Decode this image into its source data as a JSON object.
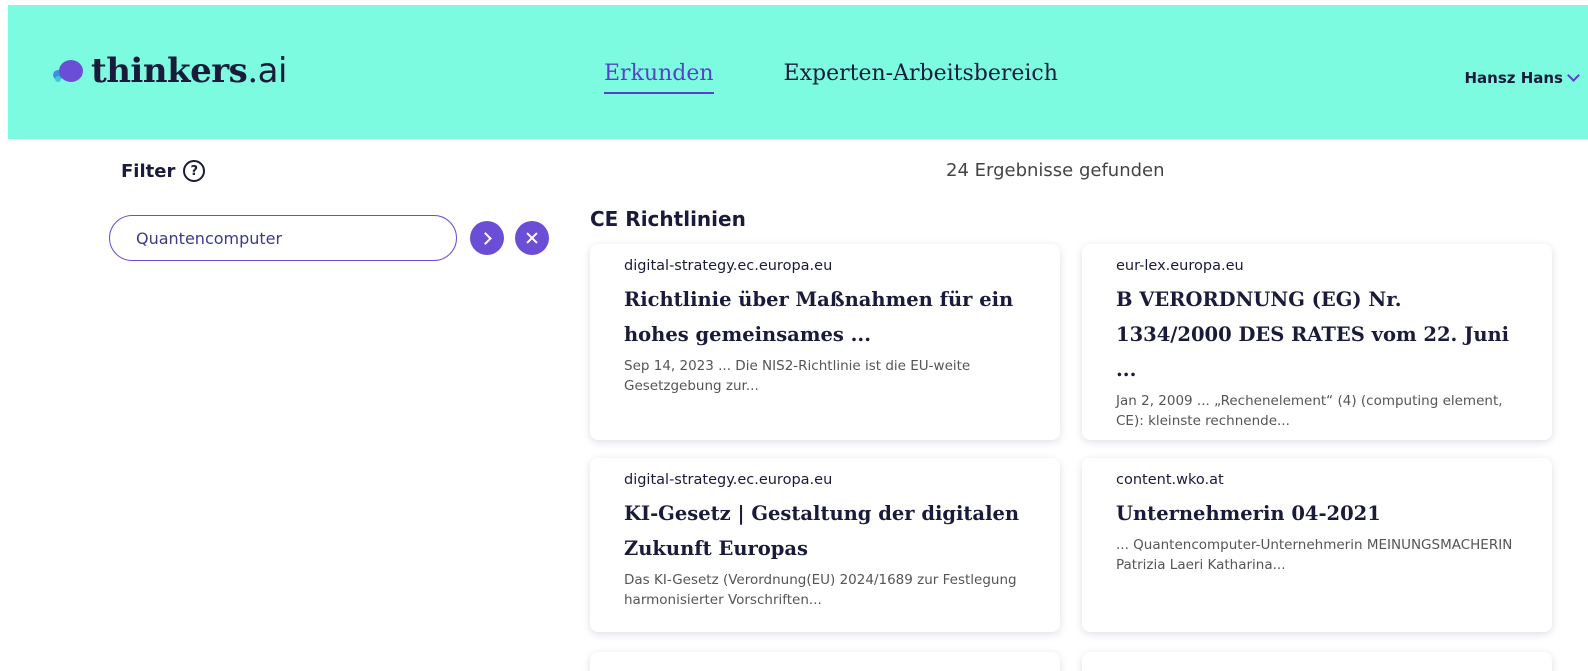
{
  "header": {
    "logo": {
      "name": "thinkers",
      "dot": ".",
      "suffix": "ai"
    },
    "nav": [
      {
        "label": "Erkunden",
        "active": true
      },
      {
        "label": "Experten-Arbeitsbereich",
        "active": false
      }
    ],
    "user": {
      "name": "Hansz Hans",
      "icon": "chevron-down-icon"
    },
    "background": "#7dfbe0",
    "accent": "#5a3fc9"
  },
  "filter": {
    "title": "Filter",
    "help_icon": "?",
    "search_value": "Quantencomputer",
    "go_icon": "chevron-right-icon",
    "clear_icon": "close-icon"
  },
  "results": {
    "count_text": "24 Ergebnisse gefunden",
    "section_title": "CE Richtlinien",
    "cards": [
      {
        "source": "digital-strategy.ec.europa.eu",
        "title": "Richtlinie über Maßnahmen für ein hohes gemeinsames ...",
        "snippet": "Sep 14, 2023 ... Die NIS2-Richtlinie ist die EU-weite Gesetzgebung zur..."
      },
      {
        "source": "eur-lex.europa.eu",
        "title": "B VERORDNUNG (EG) Nr. 1334/2000 DES RATES vom 22. Juni ...",
        "snippet": "Jan 2, 2009 ... „Rechenelement“ (4) (computing element, CE): kleinste rechnende..."
      },
      {
        "source": "digital-strategy.ec.europa.eu",
        "title": "KI-Gesetz | Gestaltung der digitalen Zukunft Europas",
        "snippet": "Das KI-Gesetz (Verordnung(EU) 2024/1689 zur Festlegung harmonisierter Vorschriften..."
      },
      {
        "source": "content.wko.at",
        "title": "Unternehmerin 04-2021",
        "snippet": "... Quantencomputer-Unternehmerin MEINUNGSMACHERIN Patrizia Laeri Katharina..."
      }
    ]
  }
}
